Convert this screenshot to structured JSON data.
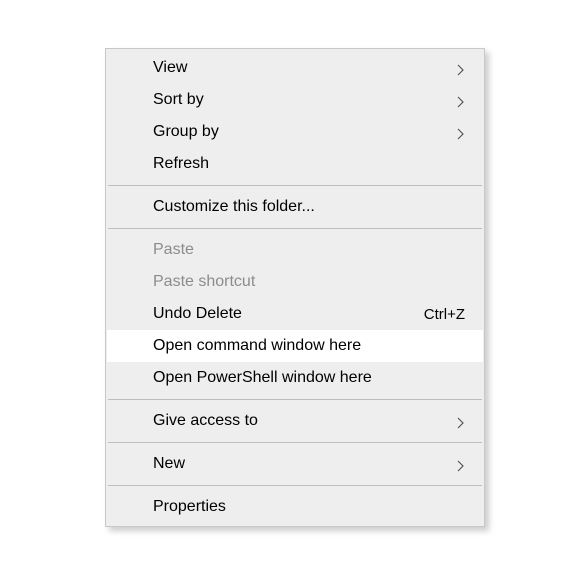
{
  "menu": {
    "view": "View",
    "sort_by": "Sort by",
    "group_by": "Group by",
    "refresh": "Refresh",
    "customize": "Customize this folder...",
    "paste": "Paste",
    "paste_shortcut": "Paste shortcut",
    "undo_delete": "Undo Delete",
    "undo_delete_accel": "Ctrl+Z",
    "open_cmd": "Open command window here",
    "open_ps": "Open PowerShell window here",
    "give_access": "Give access to",
    "new": "New",
    "properties": "Properties"
  }
}
